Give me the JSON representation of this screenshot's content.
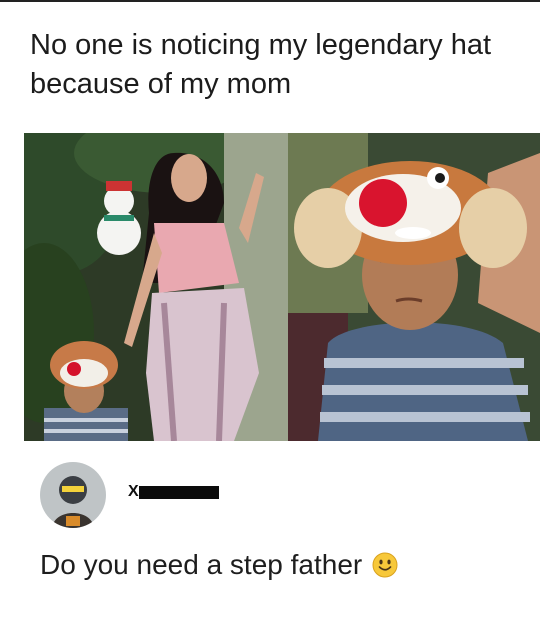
{
  "post": {
    "caption": "No one is noticing my legendary hat because of my mom"
  },
  "comment": {
    "username_visible": "X",
    "text": "Do you need a step father",
    "emoji": "smiley-emoji"
  },
  "icons": [
    "smiley-emoji",
    "avatar"
  ]
}
